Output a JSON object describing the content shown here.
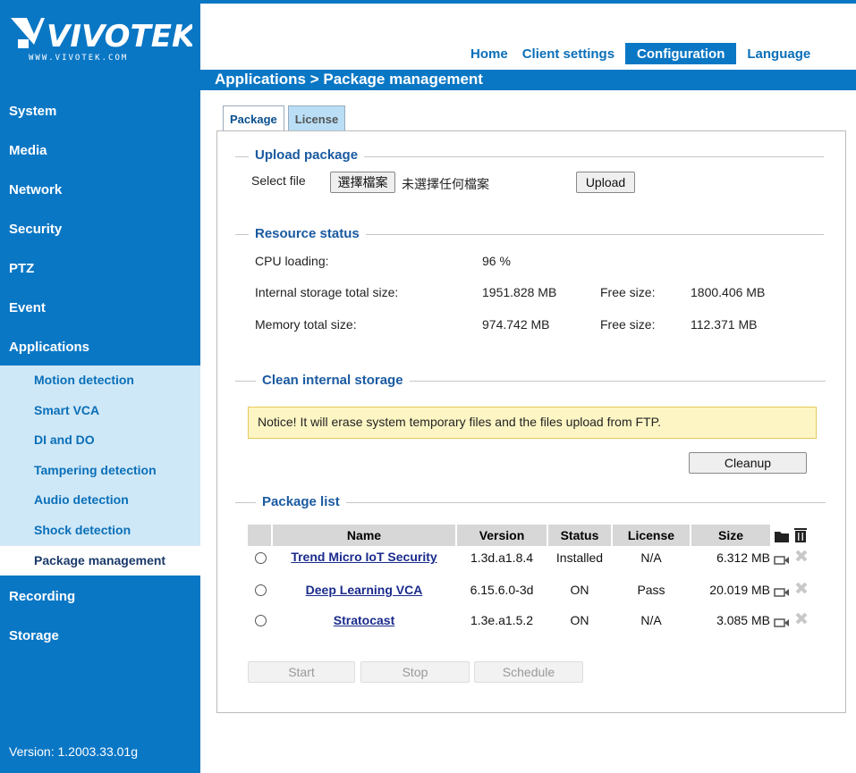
{
  "brand": {
    "logo_text": "VIVOTEK",
    "logo_url_text": "WWW.VIVOTEK.COM"
  },
  "nav": {
    "home": "Home",
    "client_settings": "Client settings",
    "configuration": "Configuration",
    "language": "Language"
  },
  "breadcrumb": "Applications  > Package management",
  "sidebar": {
    "items": [
      "System",
      "Media",
      "Network",
      "Security",
      "PTZ",
      "Event",
      "Applications"
    ],
    "sub_items": [
      "Motion detection",
      "Smart VCA",
      "DI and DO",
      "Tampering detection",
      "Audio detection",
      "Shock detection",
      "Package management"
    ],
    "items_after": [
      "Recording",
      "Storage"
    ],
    "version": "Version: 1.2003.33.01g"
  },
  "tabs": {
    "package": "Package",
    "license": "License"
  },
  "upload": {
    "title": "Upload package",
    "select_label": "Select file",
    "choose_button": "選擇檔案",
    "no_file_text": "未選擇任何檔案",
    "upload_button": "Upload"
  },
  "resource": {
    "title": "Resource status",
    "cpu_label": "CPU loading:",
    "cpu_value": "96 %",
    "storage_label": "Internal storage total size:",
    "storage_value": "1951.828 MB",
    "storage_free_label": "Free size:",
    "storage_free_value": "1800.406 MB",
    "memory_label": "Memory total size:",
    "memory_value": "974.742 MB",
    "memory_free_label": "Free size:",
    "memory_free_value": "112.371 MB"
  },
  "clean": {
    "title": "Clean internal storage",
    "notice": "Notice! It will erase system temporary files and the files upload from FTP.",
    "cleanup_button": "Cleanup"
  },
  "package_list": {
    "title": "Package list",
    "headers": {
      "name": "Name",
      "version": "Version",
      "status": "Status",
      "license": "License",
      "size": "Size"
    },
    "rows": [
      {
        "name": "Trend Micro IoT Security",
        "version": "1.3d.a1.8.4",
        "status": "Installed",
        "license": "N/A",
        "size": "6.312 MB"
      },
      {
        "name": "Deep Learning VCA",
        "version": "6.15.6.0-3d",
        "status": "ON",
        "license": "Pass",
        "size": "20.019 MB"
      },
      {
        "name": "Stratocast",
        "version": "1.3e.a1.5.2",
        "status": "ON",
        "license": "N/A",
        "size": "3.085 MB"
      }
    ],
    "buttons": {
      "start": "Start",
      "stop": "Stop",
      "schedule": "Schedule"
    }
  },
  "colors": {
    "brand_blue": "#0a77c5",
    "sidebar_sub_bg": "#cfe8f7",
    "notice_bg": "#fdf6c4",
    "link": "#1a2b8c"
  }
}
